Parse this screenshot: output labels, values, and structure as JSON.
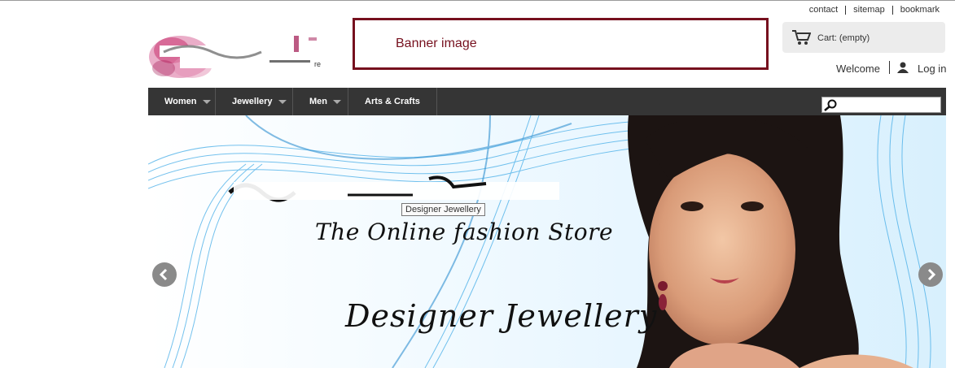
{
  "top_links": {
    "contact": "contact",
    "sitemap": "sitemap",
    "bookmark": "bookmark"
  },
  "banner": {
    "label": "Banner image"
  },
  "cart": {
    "label": "Cart: (empty)"
  },
  "account": {
    "welcome": "Welcome",
    "login": "Log in"
  },
  "nav": {
    "items": [
      {
        "label": "Women",
        "has_dropdown": true
      },
      {
        "label": "Jewellery",
        "has_dropdown": true
      },
      {
        "label": "Men",
        "has_dropdown": true
      },
      {
        "label": "Arts & Crafts",
        "has_dropdown": false
      }
    ],
    "search": {
      "value": "",
      "icon": "magnifier-icon"
    }
  },
  "hero": {
    "tooltip": "Designer Jewellery",
    "tagline": "The Online fashion Store",
    "headline": "Designer Jewellery",
    "prev_icon": "arrow-left-icon",
    "next_icon": "arrow-right-icon"
  },
  "colors": {
    "banner_border": "#76101e",
    "nav_background": "#353535",
    "cart_background": "#ececec",
    "hero_accent": "#3aa8e6"
  }
}
